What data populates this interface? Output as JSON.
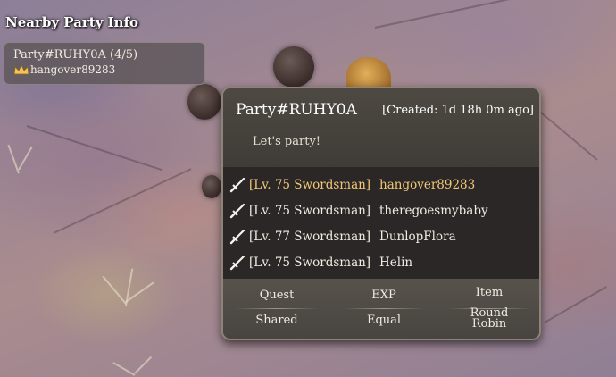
{
  "nearby": {
    "title": "Nearby Party Info",
    "party": {
      "name": "Party#RUHY0A (4/5)",
      "leader": "hangover89283",
      "leader_icon": "crown-icon"
    }
  },
  "popup": {
    "title": "Party#RUHY0A",
    "created": "[Created: 1d 18h 0m ago]",
    "message": "Let's party!",
    "member_icon": "sword-icon",
    "members": [
      {
        "info": "[Lv. 75 Swordsman]",
        "name": "hangover89283",
        "leader": true
      },
      {
        "info": "[Lv. 75 Swordsman]",
        "name": "theregoesmybaby",
        "leader": false
      },
      {
        "info": "[Lv. 77 Swordsman]",
        "name": "DunlopFlora",
        "leader": false
      },
      {
        "info": "[Lv. 75 Swordsman]",
        "name": "Helin",
        "leader": false
      }
    ],
    "settings": [
      {
        "label": "Quest",
        "value": "Shared"
      },
      {
        "label": "EXP",
        "value": "Equal"
      },
      {
        "label": "Item",
        "value": "Round Robin"
      }
    ]
  },
  "colors": {
    "leader_text": "#f3c978",
    "panel_bg": "#2d2a29",
    "panel_border": "#8c8478"
  }
}
